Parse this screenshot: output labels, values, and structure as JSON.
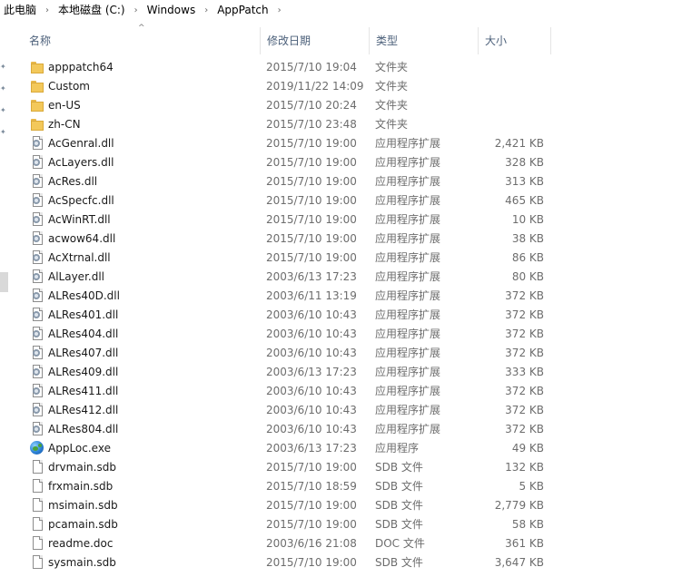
{
  "breadcrumb": [
    "此电脑",
    "本地磁盘 (C:)",
    "Windows",
    "AppPatch"
  ],
  "columns": {
    "name": "名称",
    "date": "修改日期",
    "type": "类型",
    "size": "大小"
  },
  "files": [
    {
      "name": "apppatch64",
      "date": "2015/7/10 19:04",
      "type": "文件夹",
      "size": "",
      "icon": "folder-icon"
    },
    {
      "name": "Custom",
      "date": "2019/11/22 14:09",
      "type": "文件夹",
      "size": "",
      "icon": "folder-icon"
    },
    {
      "name": "en-US",
      "date": "2015/7/10 20:24",
      "type": "文件夹",
      "size": "",
      "icon": "folder-icon"
    },
    {
      "name": "zh-CN",
      "date": "2015/7/10 23:48",
      "type": "文件夹",
      "size": "",
      "icon": "folder-icon"
    },
    {
      "name": "AcGenral.dll",
      "date": "2015/7/10 19:00",
      "type": "应用程序扩展",
      "size": "2,421 KB",
      "icon": "dll-icon"
    },
    {
      "name": "AcLayers.dll",
      "date": "2015/7/10 19:00",
      "type": "应用程序扩展",
      "size": "328 KB",
      "icon": "dll-icon"
    },
    {
      "name": "AcRes.dll",
      "date": "2015/7/10 19:00",
      "type": "应用程序扩展",
      "size": "313 KB",
      "icon": "dll-icon"
    },
    {
      "name": "AcSpecfc.dll",
      "date": "2015/7/10 19:00",
      "type": "应用程序扩展",
      "size": "465 KB",
      "icon": "dll-icon"
    },
    {
      "name": "AcWinRT.dll",
      "date": "2015/7/10 19:00",
      "type": "应用程序扩展",
      "size": "10 KB",
      "icon": "dll-icon"
    },
    {
      "name": "acwow64.dll",
      "date": "2015/7/10 19:00",
      "type": "应用程序扩展",
      "size": "38 KB",
      "icon": "dll-icon"
    },
    {
      "name": "AcXtrnal.dll",
      "date": "2015/7/10 19:00",
      "type": "应用程序扩展",
      "size": "86 KB",
      "icon": "dll-icon"
    },
    {
      "name": "AlLayer.dll",
      "date": "2003/6/13 17:23",
      "type": "应用程序扩展",
      "size": "80 KB",
      "icon": "dll-icon"
    },
    {
      "name": "ALRes40D.dll",
      "date": "2003/6/11 13:19",
      "type": "应用程序扩展",
      "size": "372 KB",
      "icon": "dll-icon"
    },
    {
      "name": "ALRes401.dll",
      "date": "2003/6/10 10:43",
      "type": "应用程序扩展",
      "size": "372 KB",
      "icon": "dll-icon"
    },
    {
      "name": "ALRes404.dll",
      "date": "2003/6/10 10:43",
      "type": "应用程序扩展",
      "size": "372 KB",
      "icon": "dll-icon"
    },
    {
      "name": "ALRes407.dll",
      "date": "2003/6/10 10:43",
      "type": "应用程序扩展",
      "size": "372 KB",
      "icon": "dll-icon"
    },
    {
      "name": "ALRes409.dll",
      "date": "2003/6/13 17:23",
      "type": "应用程序扩展",
      "size": "333 KB",
      "icon": "dll-icon"
    },
    {
      "name": "ALRes411.dll",
      "date": "2003/6/10 10:43",
      "type": "应用程序扩展",
      "size": "372 KB",
      "icon": "dll-icon"
    },
    {
      "name": "ALRes412.dll",
      "date": "2003/6/10 10:43",
      "type": "应用程序扩展",
      "size": "372 KB",
      "icon": "dll-icon"
    },
    {
      "name": "ALRes804.dll",
      "date": "2003/6/10 10:43",
      "type": "应用程序扩展",
      "size": "372 KB",
      "icon": "dll-icon"
    },
    {
      "name": "AppLoc.exe",
      "date": "2003/6/13 17:23",
      "type": "应用程序",
      "size": "49 KB",
      "icon": "application-icon"
    },
    {
      "name": "drvmain.sdb",
      "date": "2015/7/10 19:00",
      "type": "SDB 文件",
      "size": "132 KB",
      "icon": "file-icon"
    },
    {
      "name": "frxmain.sdb",
      "date": "2015/7/10 18:59",
      "type": "SDB 文件",
      "size": "5 KB",
      "icon": "file-icon"
    },
    {
      "name": "msimain.sdb",
      "date": "2015/7/10 19:00",
      "type": "SDB 文件",
      "size": "2,779 KB",
      "icon": "file-icon"
    },
    {
      "name": "pcamain.sdb",
      "date": "2015/7/10 19:00",
      "type": "SDB 文件",
      "size": "58 KB",
      "icon": "file-icon"
    },
    {
      "name": "readme.doc",
      "date": "2003/6/16 21:08",
      "type": "DOC 文件",
      "size": "361 KB",
      "icon": "file-icon"
    },
    {
      "name": "sysmain.sdb",
      "date": "2015/7/10 19:00",
      "type": "SDB 文件",
      "size": "3,647 KB",
      "icon": "file-icon"
    }
  ]
}
